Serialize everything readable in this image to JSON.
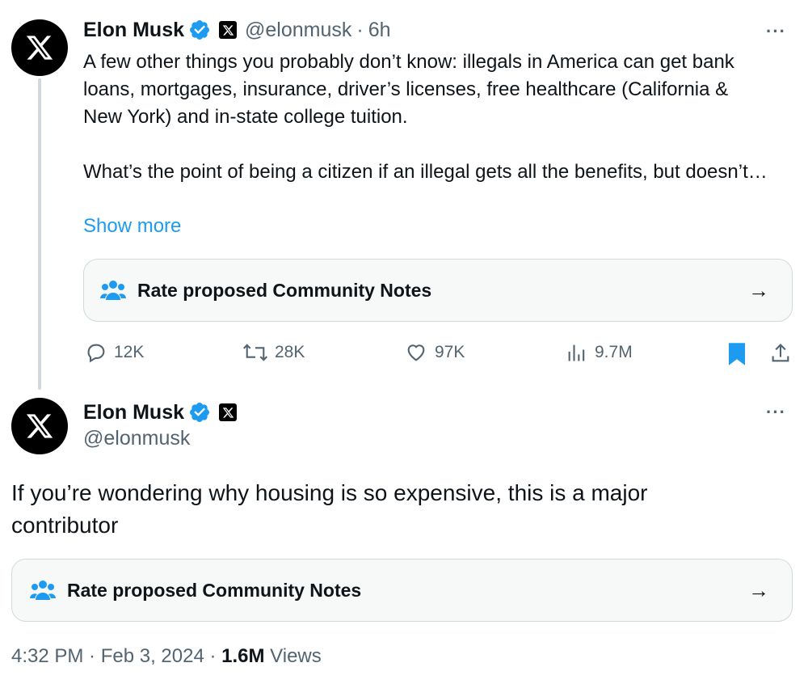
{
  "tweet1": {
    "author_name": "Elon Musk",
    "handle": "@elonmusk",
    "separator": "·",
    "time": "6h",
    "more_label": "···",
    "text": "A few other things you probably don’t know: illegals in America can get bank loans, mortgages, insurance, driver’s licenses, free healthcare (California & New York) and in-state college tuition.\n\nWhat’s the point of being a citizen if an illegal gets all the benefits, but doesn’t…",
    "show_more": "Show more",
    "community_notes": "Rate proposed Community Notes",
    "arrow": "→",
    "stats": {
      "replies": "12K",
      "reposts": "28K",
      "likes": "97K",
      "views": "9.7M"
    }
  },
  "tweet2": {
    "author_name": "Elon Musk",
    "handle": "@elonmusk",
    "more_label": "···",
    "text": "If you’re wondering why housing is so expensive, this is a major contributor",
    "community_notes": "Rate proposed Community Notes",
    "arrow": "→",
    "timestamp": "4:32 PM · Feb 3, 2024 · ",
    "views_count": "1.6M",
    "views_label": " Views"
  },
  "icons": {
    "verified": "verified-badge-icon",
    "x_logo": "x-logo-icon",
    "community": "community-notes-icon",
    "reply": "reply-icon",
    "repost": "repost-icon",
    "like": "heart-icon",
    "views": "views-icon",
    "bookmark": "bookmark-icon",
    "share": "share-icon"
  },
  "colors": {
    "accent": "#1d9bf0",
    "text": "#0f1419",
    "secondary": "#536471",
    "verified": "#1d9bf0"
  }
}
